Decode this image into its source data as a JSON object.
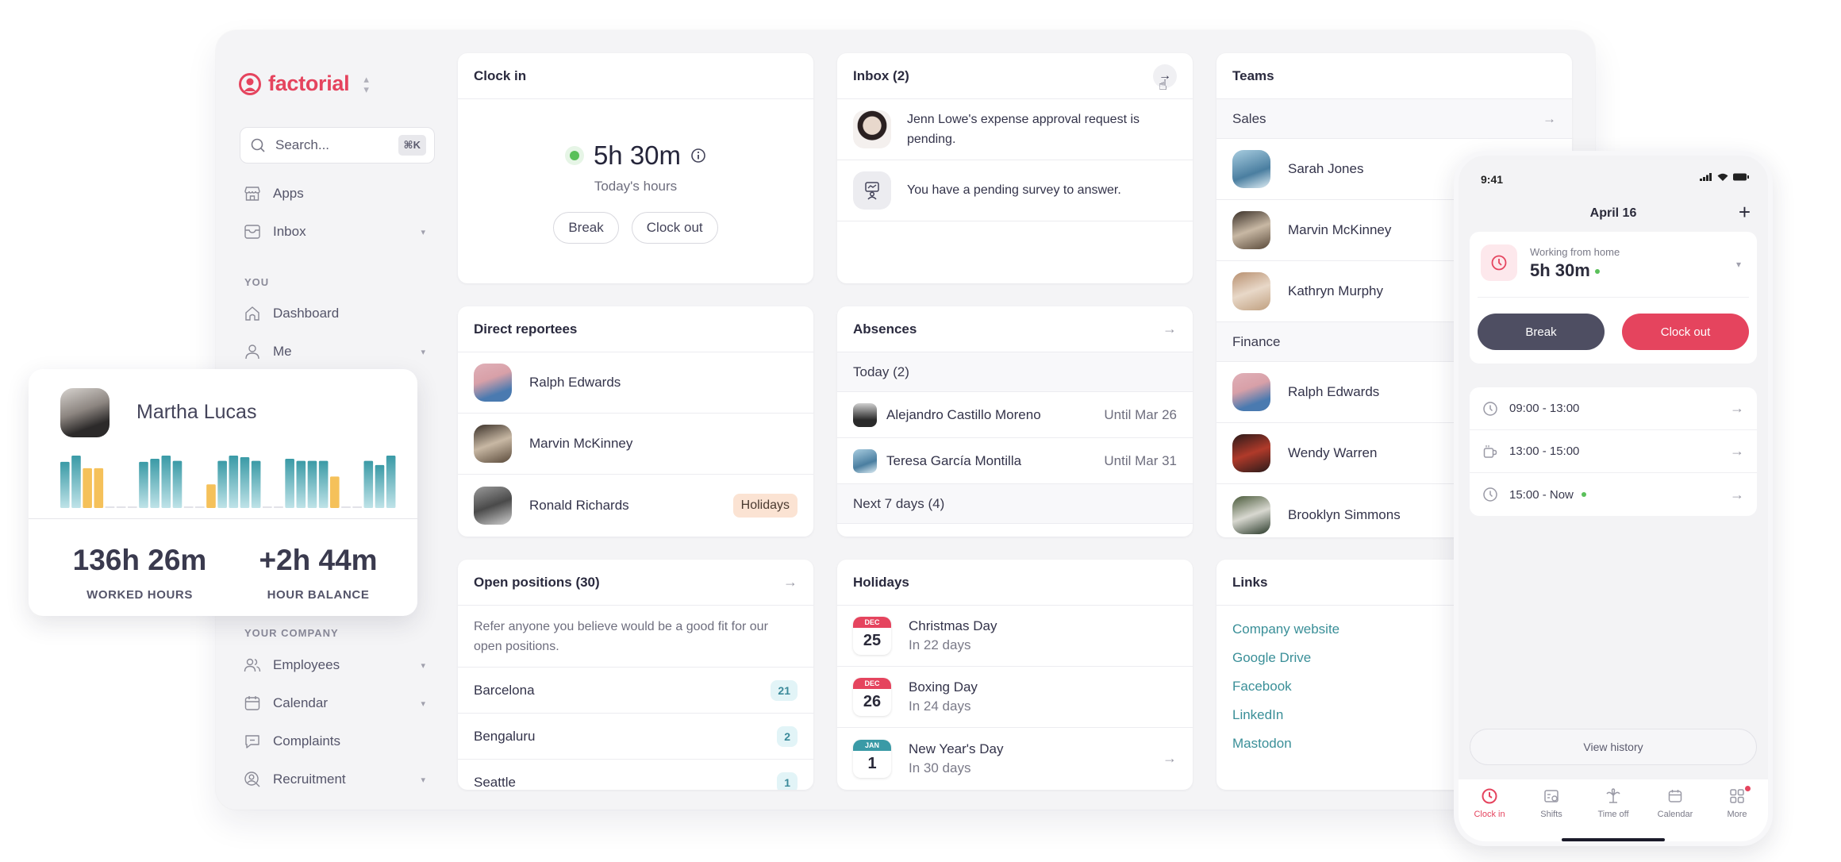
{
  "brand": {
    "name": "factorial",
    "color": "#e5445e"
  },
  "sidebar": {
    "search_placeholder": "Search...",
    "search_shortcut": "⌘K",
    "top_items": [
      {
        "label": "Apps",
        "icon": "store-icon",
        "has_chevron": false
      },
      {
        "label": "Inbox",
        "icon": "inbox-icon",
        "has_chevron": true
      }
    ],
    "you_label": "YOU",
    "you_items": [
      {
        "label": "Dashboard",
        "icon": "home-icon",
        "has_chevron": false
      },
      {
        "label": "Me",
        "icon": "user-icon",
        "has_chevron": true
      }
    ],
    "company_label": "YOUR COMPANY",
    "company_items": [
      {
        "label": "Employees",
        "icon": "users-icon",
        "has_chevron": true
      },
      {
        "label": "Calendar",
        "icon": "calendar-icon",
        "has_chevron": true
      },
      {
        "label": "Complaints",
        "icon": "chat-icon",
        "has_chevron": false
      },
      {
        "label": "Recruitment",
        "icon": "recruit-icon",
        "has_chevron": true
      }
    ]
  },
  "clock_in": {
    "title": "Clock in",
    "hours": "5h 30m",
    "hours_label": "Today's hours",
    "break_label": "Break",
    "clock_out_label": "Clock out",
    "status": "active"
  },
  "inbox": {
    "title": "Inbox (2)",
    "items": [
      {
        "text": "Jenn Lowe's expense approval request is pending.",
        "icon": "avatar"
      },
      {
        "text": "You have a pending survey to answer.",
        "icon": "survey-icon"
      }
    ]
  },
  "teams": {
    "title": "Teams",
    "groups": [
      {
        "name": "Sales",
        "members": [
          "Sarah Jones",
          "Marvin McKinney",
          "Kathryn Murphy"
        ]
      },
      {
        "name": "Finance",
        "members": [
          "Ralph Edwards",
          "Wendy Warren",
          "Brooklyn Simmons"
        ]
      }
    ]
  },
  "direct_reportees": {
    "title": "Direct reportees",
    "items": [
      {
        "name": "Ralph Edwards",
        "badge": ""
      },
      {
        "name": "Marvin McKinney",
        "badge": ""
      },
      {
        "name": "Ronald Richards",
        "badge": "Holidays"
      }
    ]
  },
  "absences": {
    "title": "Absences",
    "today_label": "Today (2)",
    "today": [
      {
        "name": "Alejandro Castillo Moreno",
        "until": "Until Mar 26"
      },
      {
        "name": "Teresa García Montilla",
        "until": "Until Mar 31"
      }
    ],
    "next_label": "Next 7 days (4)"
  },
  "open_positions": {
    "title": "Open positions (30)",
    "description": "Refer anyone you believe would be a good fit for our open positions.",
    "items": [
      {
        "city": "Barcelona",
        "count": "21"
      },
      {
        "city": "Bengaluru",
        "count": "2"
      },
      {
        "city": "Seattle",
        "count": "1"
      }
    ]
  },
  "holidays": {
    "title": "Holidays",
    "items": [
      {
        "month": "DEC",
        "day": "25",
        "name": "Christmas Day",
        "when": "In 22 days",
        "month_color": "#e5445e"
      },
      {
        "month": "DEC",
        "day": "26",
        "name": "Boxing Day",
        "when": "In 24 days",
        "month_color": "#e5445e"
      },
      {
        "month": "JAN",
        "day": "1",
        "name": "New Year's Day",
        "when": "In 30 days",
        "month_color": "#3a9aa6"
      }
    ]
  },
  "links": {
    "title": "Links",
    "items": [
      "Company website",
      "Google Drive",
      "Facebook",
      "LinkedIn",
      "Mastodon"
    ]
  },
  "employee_summary": {
    "name": "Martha Lucas",
    "worked_hours": "136h 26m",
    "worked_label": "WORKED HOURS",
    "balance": "+2h 44m",
    "balance_label": "HOUR BALANCE",
    "daily_bars": [
      {
        "v": 0.88,
        "t": "work"
      },
      {
        "v": 1.0,
        "t": "work"
      },
      {
        "v": 0.76,
        "t": "absence"
      },
      {
        "v": 0.76,
        "t": "absence"
      },
      {
        "v": 0,
        "t": "off"
      },
      {
        "v": 0,
        "t": "off"
      },
      {
        "v": 0,
        "t": "off"
      },
      {
        "v": 0.88,
        "t": "work"
      },
      {
        "v": 0.94,
        "t": "work"
      },
      {
        "v": 1.0,
        "t": "work"
      },
      {
        "v": 0.9,
        "t": "work"
      },
      {
        "v": 0,
        "t": "off"
      },
      {
        "v": 0,
        "t": "off"
      },
      {
        "v": 0.45,
        "t": "absence"
      },
      {
        "v": 0.9,
        "t": "work"
      },
      {
        "v": 1.0,
        "t": "work"
      },
      {
        "v": 0.97,
        "t": "work"
      },
      {
        "v": 0.9,
        "t": "work"
      },
      {
        "v": 0,
        "t": "off"
      },
      {
        "v": 0,
        "t": "off"
      },
      {
        "v": 0.94,
        "t": "work"
      },
      {
        "v": 0.9,
        "t": "work"
      },
      {
        "v": 0.9,
        "t": "work"
      },
      {
        "v": 0.9,
        "t": "work"
      },
      {
        "v": 0.6,
        "t": "absence"
      },
      {
        "v": 0,
        "t": "off"
      },
      {
        "v": 0,
        "t": "off"
      },
      {
        "v": 0.9,
        "t": "work"
      },
      {
        "v": 0.82,
        "t": "work"
      },
      {
        "v": 1.0,
        "t": "work"
      }
    ],
    "colors": {
      "work": "#3a9aa6",
      "absence": "#f5c15a",
      "off": "#e2e2e8"
    }
  },
  "mobile": {
    "status_time": "9:41",
    "date_title": "April 16",
    "location": "Working from home",
    "hours": "5h 30m",
    "break_label": "Break",
    "clock_out_label": "Clock out",
    "slots": [
      {
        "range": "09:00 - 13:00",
        "icon": "clock-icon",
        "live": false
      },
      {
        "range": "13:00 - 15:00",
        "icon": "coffee-icon",
        "live": false
      },
      {
        "range": "15:00 -  Now",
        "icon": "clock-icon",
        "live": true
      }
    ],
    "history_label": "View history",
    "tabs": [
      {
        "label": "Clock in",
        "active": true,
        "icon": "clock-icon"
      },
      {
        "label": "Shifts",
        "active": false,
        "icon": "shifts-icon"
      },
      {
        "label": "Time off",
        "active": false,
        "icon": "palm-tree-icon"
      },
      {
        "label": "Calendar",
        "active": false,
        "icon": "calendar-icon"
      },
      {
        "label": "More",
        "active": false,
        "icon": "grid-icon",
        "notification": true
      }
    ]
  }
}
